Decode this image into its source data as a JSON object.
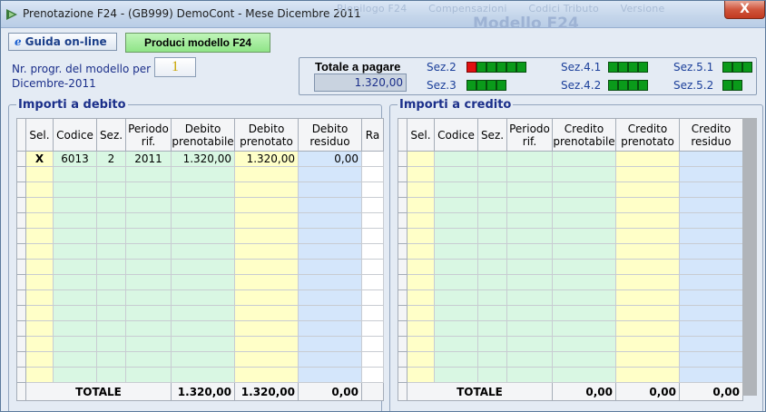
{
  "window": {
    "title": "Prenotazione F24 - (GB999) DemoCont  - Mese Dicembre 2011",
    "close_symbol": "X",
    "ghost_menu": [
      "Riepilogo F24",
      "Compensazioni",
      "Codici Tributo",
      "Versione"
    ],
    "ghost_title": "Modello F24"
  },
  "toolbar": {
    "help_icon": "e",
    "help_label": "Guida on-line",
    "produce_label": "Produci modello F24"
  },
  "progressivo": {
    "label": "Nr. progr. del modello per Dicembre-2011",
    "value": "1"
  },
  "totale": {
    "label": "Totale a pagare",
    "value": "1.320,00"
  },
  "sezioni": [
    {
      "label": "Sez.2",
      "cells": [
        "red",
        "green",
        "green",
        "green",
        "green",
        "green"
      ]
    },
    {
      "label": "Sez.3",
      "cells": [
        "green",
        "green",
        "green",
        "green"
      ]
    },
    {
      "label": "Sez.4.1",
      "cells": [
        "green",
        "green",
        "green",
        "green"
      ]
    },
    {
      "label": "Sez.4.2",
      "cells": [
        "green",
        "green",
        "green",
        "green"
      ]
    },
    {
      "label": "Sez.5.1",
      "cells": [
        "green",
        "green",
        "green"
      ]
    },
    {
      "label": "Sez.5.2",
      "cells": [
        "green",
        "green"
      ]
    }
  ],
  "colors": {
    "status_green": "#0a9a1a",
    "status_red": "#e01010",
    "accent_blue": "#1b2f8a",
    "button_green": "#8fe487"
  },
  "debito": {
    "title": "Importi a debito",
    "headers": [
      "Sel.",
      "Codice",
      "Sez.",
      "Periodo rif.",
      "Debito prenotabile",
      "Debito prenotato",
      "Debito residuo",
      "Ra"
    ],
    "rows": [
      {
        "sel": "X",
        "codice": "6013",
        "sez": "2",
        "periodo": "2011",
        "prenotabile": "1.320,00",
        "prenotato": "1.320,00",
        "residuo": "0,00"
      }
    ],
    "total_label": "TOTALE",
    "total_prenotabile": "1.320,00",
    "total_prenotato": "1.320,00",
    "total_residuo": "0,00"
  },
  "credito": {
    "title": "Importi a credito",
    "headers": [
      "Sel.",
      "Codice",
      "Sez.",
      "Periodo rif.",
      "Credito prenotabile",
      "Credito prenotato",
      "Credito residuo"
    ],
    "rows": [],
    "total_label": "TOTALE",
    "total_prenotabile": "0,00",
    "total_prenotato": "0,00",
    "total_residuo": "0,00"
  }
}
